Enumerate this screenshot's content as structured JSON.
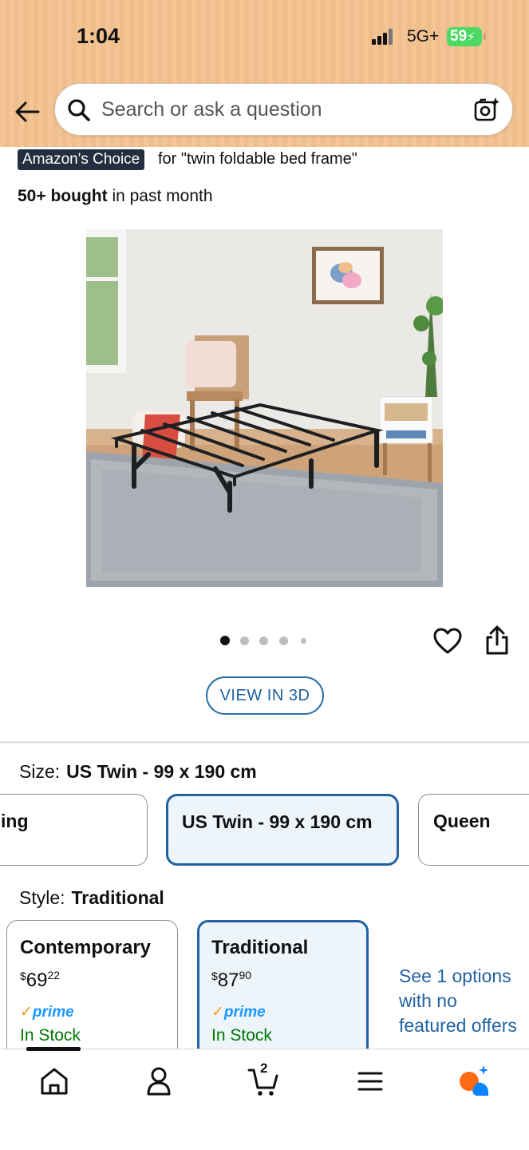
{
  "status_bar": {
    "time": "1:04",
    "network": "5G+",
    "battery": "59"
  },
  "search": {
    "placeholder": "Search or ask a question"
  },
  "product": {
    "badge": "Amazon's Choice",
    "badge_for": "for \"twin foldable bed frame\"",
    "bought_bold": "50+ bought",
    "bought_rest": "in past month",
    "image_dots": 5,
    "active_dot": 0
  },
  "buttons": {
    "view_3d": "VIEW IN 3D"
  },
  "size": {
    "label": "Size:",
    "selected": "US Twin - 99 x 190 cm",
    "options": [
      {
        "label": "King",
        "visible_text": "ing",
        "selected": false
      },
      {
        "label": "US Twin - 99 x 190 cm",
        "visible_text": "US Twin - 99 x 190 cm",
        "selected": true
      },
      {
        "label": "Queen",
        "visible_text": "Queen",
        "selected": false
      }
    ]
  },
  "style": {
    "label": "Style:",
    "selected": "Traditional",
    "options": [
      {
        "name": "Contemporary",
        "currency": "$",
        "price_whole": "69",
        "price_fraction": "22",
        "prime": "prime",
        "stock": "In Stock",
        "selected": false
      },
      {
        "name": "Traditional",
        "currency": "$",
        "price_whole": "87",
        "price_fraction": "90",
        "prime": "prime",
        "stock": "In Stock",
        "selected": true
      }
    ],
    "see_options": "See 1 options with no featured offers"
  },
  "bottom_nav": {
    "items": [
      "home-icon",
      "account-icon",
      "cart-icon",
      "menu-icon",
      "rufus-icon"
    ],
    "cart_count": "2",
    "active": "home-icon"
  },
  "colors": {
    "header_bg": "#f3c595",
    "link_blue": "#2162a1",
    "prime_blue": "#1a98ff",
    "in_stock_green": "#007600",
    "badge_bg": "#232f3e",
    "selected_bg": "#edf5fb"
  }
}
